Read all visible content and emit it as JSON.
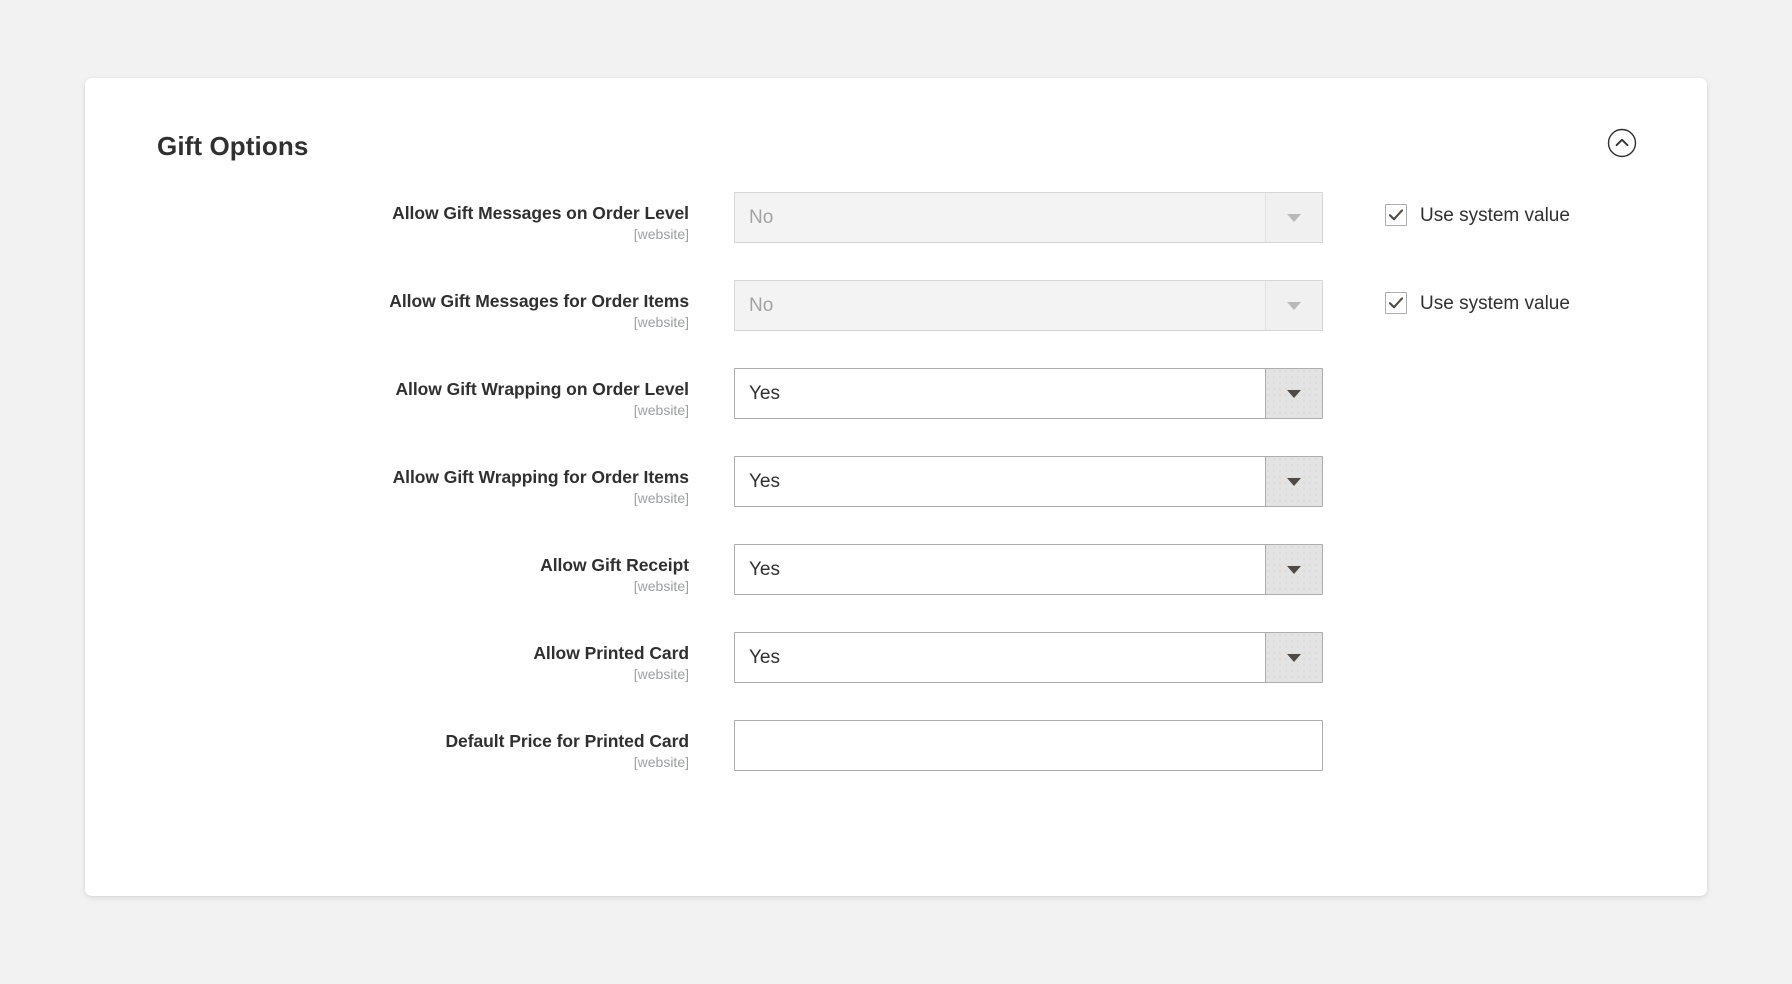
{
  "panel": {
    "title": "Gift Options",
    "collapse_icon": "chevron-up-circle-icon",
    "accent_color": "#303030",
    "card_background": "#ffffff",
    "page_background": "#f2f2f2",
    "border_color": "#adadad"
  },
  "scope_label": "[website]",
  "use_system_value_label": "Use system value",
  "rows": [
    {
      "label": "Allow Gift Messages on Order Level",
      "scope": "[website]",
      "control": "select",
      "value": "No",
      "disabled": true,
      "use_system_value": true,
      "use_system_value_checked": true
    },
    {
      "label": "Allow Gift Messages for Order Items",
      "scope": "[website]",
      "control": "select",
      "value": "No",
      "disabled": true,
      "use_system_value": true,
      "use_system_value_checked": true
    },
    {
      "label": "Allow Gift Wrapping on Order Level",
      "scope": "[website]",
      "control": "select",
      "value": "Yes",
      "disabled": false,
      "use_system_value": false,
      "use_system_value_checked": false
    },
    {
      "label": "Allow Gift Wrapping for Order Items",
      "scope": "[website]",
      "control": "select",
      "value": "Yes",
      "disabled": false,
      "use_system_value": false,
      "use_system_value_checked": false
    },
    {
      "label": "Allow Gift Receipt",
      "scope": "[website]",
      "control": "select",
      "value": "Yes",
      "disabled": false,
      "use_system_value": false,
      "use_system_value_checked": false
    },
    {
      "label": "Allow Printed Card",
      "scope": "[website]",
      "control": "select",
      "value": "Yes",
      "disabled": false,
      "use_system_value": false,
      "use_system_value_checked": false
    },
    {
      "label": "Default Price for Printed Card",
      "scope": "[website]",
      "control": "text",
      "value": "",
      "placeholder": "",
      "disabled": false,
      "use_system_value": false,
      "use_system_value_checked": false
    }
  ]
}
